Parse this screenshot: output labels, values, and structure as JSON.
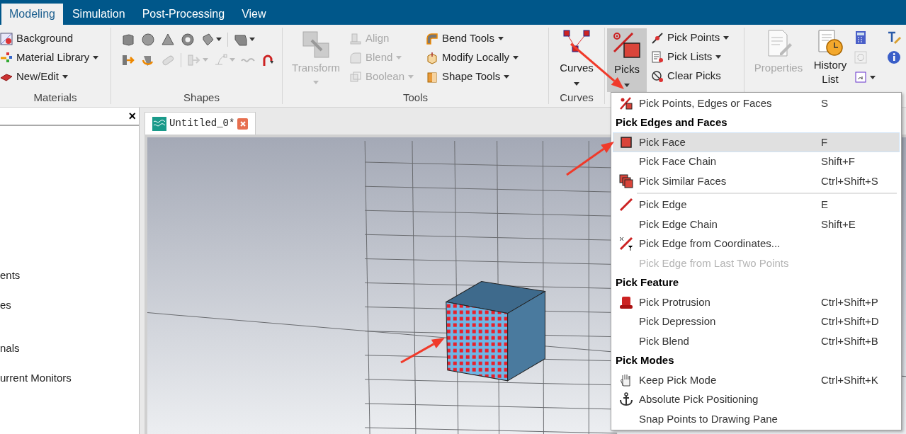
{
  "tabs": [
    {
      "label": "Modeling",
      "selected": true
    },
    {
      "label": "Simulation",
      "selected": false
    },
    {
      "label": "Post-Processing",
      "selected": false
    },
    {
      "label": "View",
      "selected": false
    }
  ],
  "ribbon": {
    "materials": {
      "label": "Materials",
      "items": [
        {
          "label": "Background",
          "dropdown": false
        },
        {
          "label": "Material Library",
          "dropdown": true
        },
        {
          "label": "New/Edit",
          "dropdown": true
        }
      ]
    },
    "shapes": {
      "label": "Shapes"
    },
    "tools": {
      "label": "Tools",
      "transform": {
        "label": "Transform",
        "disabled": true
      },
      "items": [
        {
          "label": "Align",
          "disabled": true,
          "dropdown": false
        },
        {
          "label": "Blend",
          "disabled": true,
          "dropdown": true
        },
        {
          "label": "Boolean",
          "disabled": true,
          "dropdown": true
        },
        {
          "label": "Bend Tools",
          "disabled": false,
          "dropdown": true
        },
        {
          "label": "Modify Locally",
          "disabled": false,
          "dropdown": true
        },
        {
          "label": "Shape Tools",
          "disabled": false,
          "dropdown": true
        }
      ]
    },
    "curves": {
      "label": "Curves",
      "button": "Curves"
    },
    "picks": {
      "button": "Picks",
      "pressed": true,
      "items": [
        {
          "label": "Pick Points",
          "dropdown": true
        },
        {
          "label": "Pick Lists",
          "dropdown": true
        },
        {
          "label": "Clear Picks",
          "dropdown": false
        }
      ]
    },
    "properties": {
      "label": "Properties",
      "disabled": true
    },
    "history": {
      "label": "History List"
    }
  },
  "panel_close": "×",
  "tree_items": [
    "ents",
    "es",
    "nals",
    "urrent Monitors"
  ],
  "document_tab": {
    "title": "Untitled_0*"
  },
  "menu": [
    {
      "kind": "item",
      "label": "Pick Points, Edges or Faces",
      "shortcut": "S",
      "selected": false,
      "disabled": false
    },
    {
      "kind": "header",
      "label": "Pick Edges and Faces"
    },
    {
      "kind": "item",
      "label": "Pick Face",
      "shortcut": "F",
      "selected": true,
      "disabled": false
    },
    {
      "kind": "item",
      "label": "Pick Face Chain",
      "shortcut": "Shift+F",
      "selected": false,
      "disabled": false
    },
    {
      "kind": "item",
      "label": "Pick Similar Faces",
      "shortcut": "Ctrl+Shift+S",
      "selected": false,
      "disabled": false
    },
    {
      "kind": "separator"
    },
    {
      "kind": "item",
      "label": "Pick Edge",
      "shortcut": "E",
      "selected": false,
      "disabled": false
    },
    {
      "kind": "item",
      "label": "Pick Edge Chain",
      "shortcut": "Shift+E",
      "selected": false,
      "disabled": false
    },
    {
      "kind": "item",
      "label": "Pick Edge from Coordinates...",
      "selected": false,
      "disabled": false
    },
    {
      "kind": "item",
      "label": "Pick Edge from Last Two Points",
      "selected": false,
      "disabled": true
    },
    {
      "kind": "header",
      "label": "Pick Feature"
    },
    {
      "kind": "item",
      "label": "Pick Protrusion",
      "shortcut": "Ctrl+Shift+P",
      "selected": false,
      "disabled": false
    },
    {
      "kind": "item",
      "label": "Pick Depression",
      "shortcut": "Ctrl+Shift+D",
      "selected": false,
      "disabled": false
    },
    {
      "kind": "item",
      "label": "Pick Blend",
      "shortcut": "Ctrl+Shift+B",
      "selected": false,
      "disabled": false
    },
    {
      "kind": "header",
      "label": "Pick Modes"
    },
    {
      "kind": "item",
      "label": "Keep Pick Mode",
      "shortcut": "Ctrl+Shift+K",
      "selected": false,
      "disabled": false
    },
    {
      "kind": "item",
      "label": "Absolute Pick Positioning",
      "selected": false,
      "disabled": false
    },
    {
      "kind": "item",
      "label": "Snap Points to Drawing Pane",
      "selected": false,
      "disabled": false
    }
  ]
}
